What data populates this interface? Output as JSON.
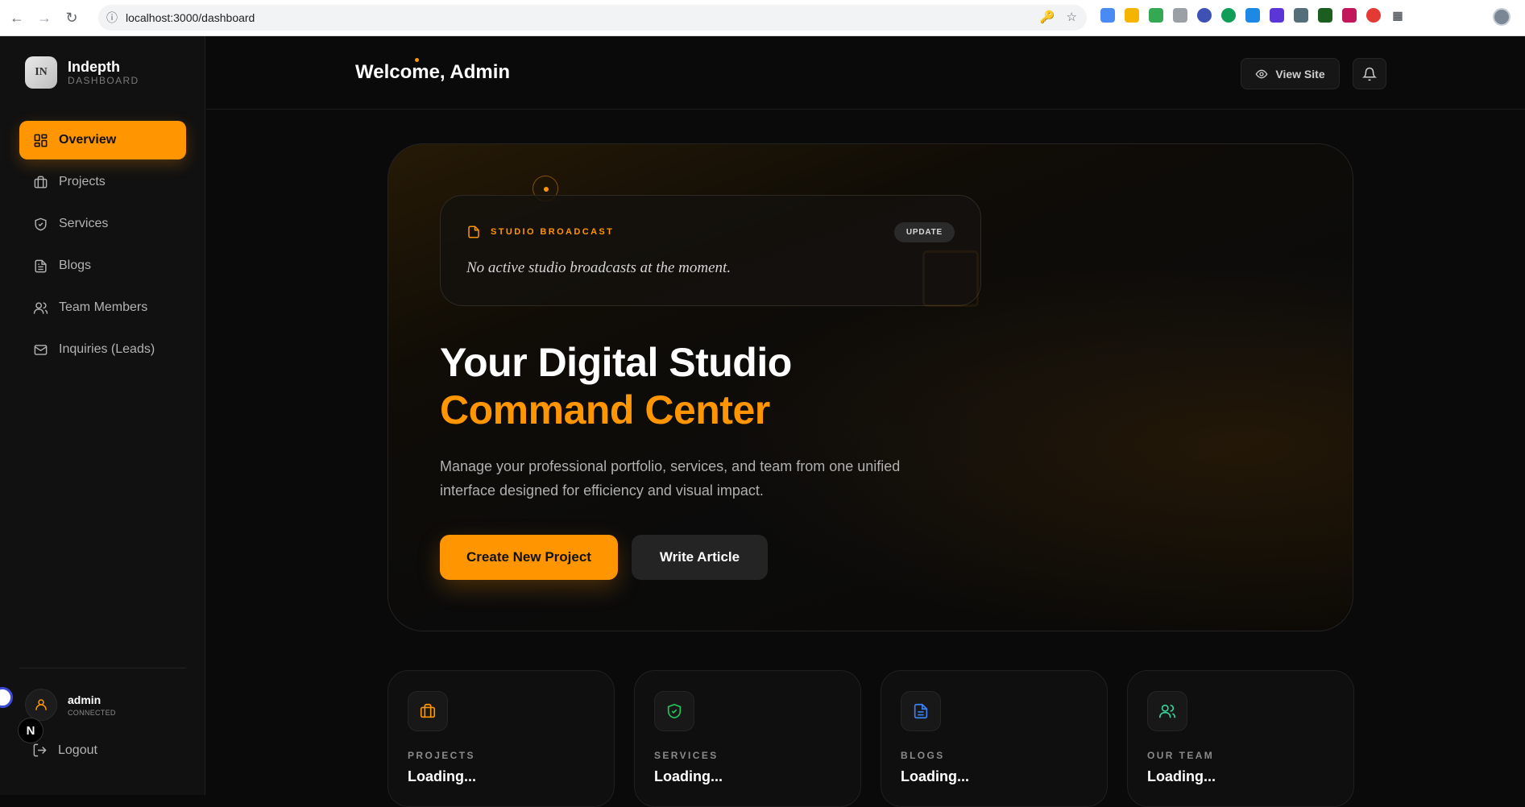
{
  "browser": {
    "url": "localhost:3000/dashboard"
  },
  "brand": {
    "name": "Indepth",
    "subtitle": "DASHBOARD"
  },
  "sidebar": {
    "items": [
      {
        "label": "Overview",
        "icon": "grid-icon",
        "active": true
      },
      {
        "label": "Projects",
        "icon": "briefcase-icon",
        "active": false
      },
      {
        "label": "Services",
        "icon": "shield-icon",
        "active": false
      },
      {
        "label": "Blogs",
        "icon": "document-icon",
        "active": false
      },
      {
        "label": "Team Members",
        "icon": "users-icon",
        "active": false
      },
      {
        "label": "Inquiries (Leads)",
        "icon": "mail-icon",
        "active": false
      }
    ],
    "user": {
      "name": "admin",
      "status": "CONNECTED"
    },
    "logout": "Logout"
  },
  "header": {
    "welcome": "Welcome, Admin",
    "view_site": "View Site"
  },
  "broadcast": {
    "title": "STUDIO BROADCAST",
    "badge": "UPDATE",
    "message": "No active studio broadcasts at the moment."
  },
  "hero": {
    "title_line1": "Your Digital Studio",
    "title_line2": "Command Center",
    "description": "Manage your professional portfolio, services, and team from one unified interface designed for efficiency and visual impact.",
    "primary_button": "Create New Project",
    "secondary_button": "Write Article"
  },
  "stats": [
    {
      "label": "PROJECTS",
      "value": "Loading...",
      "icon": "briefcase-icon",
      "color": "#ff9500"
    },
    {
      "label": "SERVICES",
      "value": "Loading...",
      "icon": "shield-check-icon",
      "color": "#22c55e"
    },
    {
      "label": "BLOGS",
      "value": "Loading...",
      "icon": "document-icon",
      "color": "#3b82f6"
    },
    {
      "label": "OUR TEAM",
      "value": "Loading...",
      "icon": "users-icon",
      "color": "#34d399"
    }
  ],
  "colors": {
    "accent": "#ff9500",
    "background": "#0a0a0a",
    "sidebar": "#111111"
  }
}
